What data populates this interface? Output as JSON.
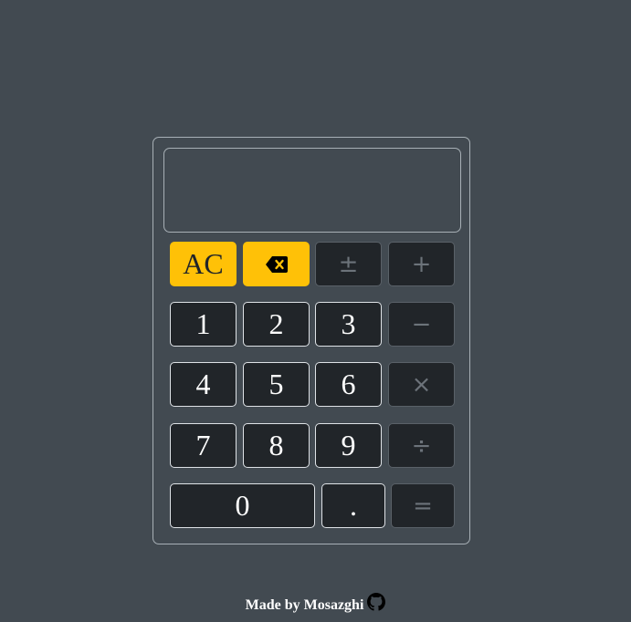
{
  "display": {
    "value": ""
  },
  "buttons": {
    "ac": "AC",
    "backspace_icon": "backspace-icon",
    "plus_minus": "±",
    "add": "+",
    "one": "1",
    "two": "2",
    "three": "3",
    "subtract": "−",
    "four": "4",
    "five": "5",
    "six": "6",
    "multiply": "×",
    "seven": "7",
    "eight": "8",
    "nine": "9",
    "divide": "÷",
    "zero": "0",
    "decimal": ".",
    "equals": "="
  },
  "footer": {
    "text": "Made by Mosazghi",
    "icon": "github-icon"
  },
  "colors": {
    "background": "#424a51",
    "accent": "#ffc107",
    "button_dark": "#212529"
  }
}
